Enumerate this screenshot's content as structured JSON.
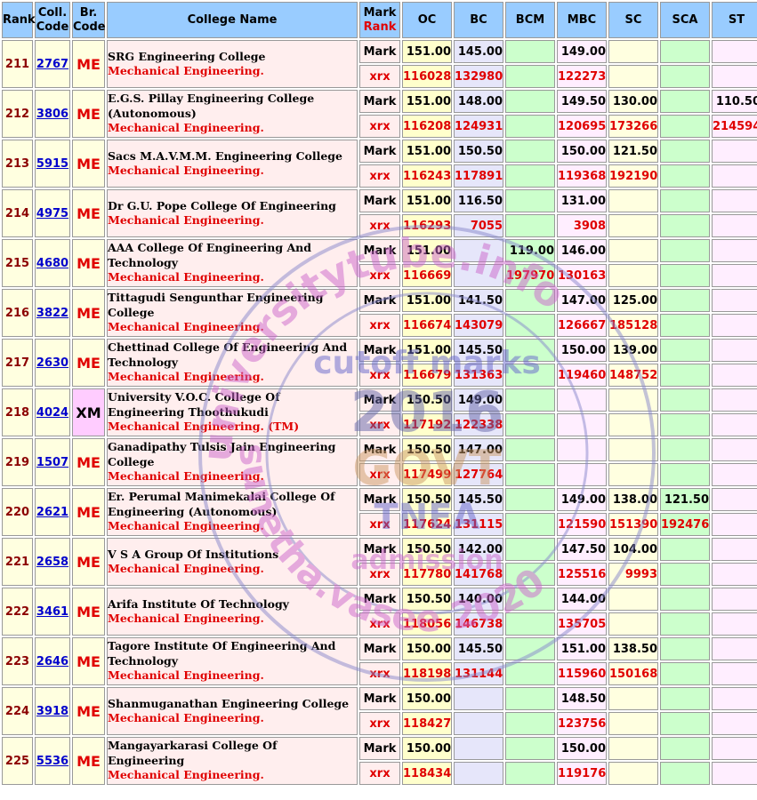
{
  "headers": {
    "rank": "Rank",
    "coll_code_1": "Coll.",
    "coll_code_2": "Code",
    "br_code_1": "Br.",
    "br_code_2": "Code",
    "college_name": "College Name",
    "mark": "Mark",
    "rank_red": "Rank",
    "oc": "OC",
    "bc": "BC",
    "bcm": "BCM",
    "mbc": "MBC",
    "sc": "SC",
    "sca": "SCA",
    "st": "ST"
  },
  "row_labels": {
    "mark": "Mark",
    "rank": "xrx"
  },
  "rows": [
    {
      "rank": "211",
      "code": "2767",
      "branch": "ME",
      "name": "SRG Engineering College",
      "branch_name": "Mechanical Engineering.",
      "marks": {
        "oc": "151.00",
        "bc": "145.00",
        "bcm": "",
        "mbc": "149.00",
        "sc": "",
        "sca": "",
        "st": ""
      },
      "ranks": {
        "oc": "116028",
        "bc": "132980",
        "bcm": "",
        "mbc": "122273",
        "sc": "",
        "sca": "",
        "st": ""
      }
    },
    {
      "rank": "212",
      "code": "3806",
      "branch": "ME",
      "name": "E.G.S. Pillay Engineering College (Autonomous)",
      "branch_name": "Mechanical Engineering.",
      "marks": {
        "oc": "151.00",
        "bc": "148.00",
        "bcm": "",
        "mbc": "149.50",
        "sc": "130.00",
        "sca": "",
        "st": "110.50"
      },
      "ranks": {
        "oc": "116208",
        "bc": "124931",
        "bcm": "",
        "mbc": "120695",
        "sc": "173266",
        "sca": "",
        "st": "214594"
      }
    },
    {
      "rank": "213",
      "code": "5915",
      "branch": "ME",
      "name": "Sacs M.A.V.M.M. Engineering College",
      "branch_name": "Mechanical Engineering.",
      "marks": {
        "oc": "151.00",
        "bc": "150.50",
        "bcm": "",
        "mbc": "150.00",
        "sc": "121.50",
        "sca": "",
        "st": ""
      },
      "ranks": {
        "oc": "116243",
        "bc": "117891",
        "bcm": "",
        "mbc": "119368",
        "sc": "192190",
        "sca": "",
        "st": ""
      }
    },
    {
      "rank": "214",
      "code": "4975",
      "branch": "ME",
      "name": "Dr G.U. Pope College Of Engineering",
      "branch_name": "Mechanical Engineering.",
      "marks": {
        "oc": "151.00",
        "bc": "116.50",
        "bcm": "",
        "mbc": "131.00",
        "sc": "",
        "sca": "",
        "st": ""
      },
      "ranks": {
        "oc": "116293",
        "bc": "7055",
        "bcm": "",
        "mbc": "3908",
        "sc": "",
        "sca": "",
        "st": ""
      }
    },
    {
      "rank": "215",
      "code": "4680",
      "branch": "ME",
      "name": "AAA College Of Engineering And Technology",
      "branch_name": "Mechanical Engineering.",
      "marks": {
        "oc": "151.00",
        "bc": "",
        "bcm": "119.00",
        "mbc": "146.00",
        "sc": "",
        "sca": "",
        "st": ""
      },
      "ranks": {
        "oc": "116669",
        "bc": "",
        "bcm": "197970",
        "mbc": "130163",
        "sc": "",
        "sca": "",
        "st": ""
      }
    },
    {
      "rank": "216",
      "code": "3822",
      "branch": "ME",
      "name": "Tittagudi Sengunthar Engineering College",
      "branch_name": "Mechanical Engineering.",
      "marks": {
        "oc": "151.00",
        "bc": "141.50",
        "bcm": "",
        "mbc": "147.00",
        "sc": "125.00",
        "sca": "",
        "st": ""
      },
      "ranks": {
        "oc": "116674",
        "bc": "143079",
        "bcm": "",
        "mbc": "126667",
        "sc": "185128",
        "sca": "",
        "st": ""
      }
    },
    {
      "rank": "217",
      "code": "2630",
      "branch": "ME",
      "name": "Chettinad College Of Engineering And Technology",
      "branch_name": "Mechanical Engineering.",
      "marks": {
        "oc": "151.00",
        "bc": "145.50",
        "bcm": "",
        "mbc": "150.00",
        "sc": "139.00",
        "sca": "",
        "st": ""
      },
      "ranks": {
        "oc": "116679",
        "bc": "131363",
        "bcm": "",
        "mbc": "119460",
        "sc": "148752",
        "sca": "",
        "st": ""
      }
    },
    {
      "rank": "218",
      "code": "4024",
      "branch": "XM",
      "name": "University V.O.C. College Of Engineering Thoothukudi",
      "branch_name": "Mechanical Engineering. (TM)",
      "marks": {
        "oc": "150.50",
        "bc": "149.00",
        "bcm": "",
        "mbc": "",
        "sc": "",
        "sca": "",
        "st": ""
      },
      "ranks": {
        "oc": "117192",
        "bc": "122338",
        "bcm": "",
        "mbc": "",
        "sc": "",
        "sca": "",
        "st": ""
      }
    },
    {
      "rank": "219",
      "code": "1507",
      "branch": "ME",
      "name": "Ganadipathy Tulsis Jain Engineering College",
      "branch_name": "Mechanical Engineering.",
      "marks": {
        "oc": "150.50",
        "bc": "147.00",
        "bcm": "",
        "mbc": "",
        "sc": "",
        "sca": "",
        "st": ""
      },
      "ranks": {
        "oc": "117499",
        "bc": "127764",
        "bcm": "",
        "mbc": "",
        "sc": "",
        "sca": "",
        "st": ""
      }
    },
    {
      "rank": "220",
      "code": "2621",
      "branch": "ME",
      "name": "Er. Perumal Manimekalai College Of Engineering (Autonomous)",
      "branch_name": "Mechanical Engineering.",
      "marks": {
        "oc": "150.50",
        "bc": "145.50",
        "bcm": "",
        "mbc": "149.00",
        "sc": "138.00",
        "sca": "121.50",
        "st": ""
      },
      "ranks": {
        "oc": "117624",
        "bc": "131115",
        "bcm": "",
        "mbc": "121590",
        "sc": "151390",
        "sca": "192476",
        "st": ""
      }
    },
    {
      "rank": "221",
      "code": "2658",
      "branch": "ME",
      "name": "V S A Group Of Institutions",
      "branch_name": "Mechanical Engineering.",
      "marks": {
        "oc": "150.50",
        "bc": "142.00",
        "bcm": "",
        "mbc": "147.50",
        "sc": "104.00",
        "sca": "",
        "st": ""
      },
      "ranks": {
        "oc": "117780",
        "bc": "141768",
        "bcm": "",
        "mbc": "125516",
        "sc": "9993",
        "sca": "",
        "st": ""
      }
    },
    {
      "rank": "222",
      "code": "3461",
      "branch": "ME",
      "name": "Arifa Institute Of Technology",
      "branch_name": "Mechanical Engineering.",
      "marks": {
        "oc": "150.50",
        "bc": "140.00",
        "bcm": "",
        "mbc": "144.00",
        "sc": "",
        "sca": "",
        "st": ""
      },
      "ranks": {
        "oc": "118056",
        "bc": "146738",
        "bcm": "",
        "mbc": "135705",
        "sc": "",
        "sca": "",
        "st": ""
      }
    },
    {
      "rank": "223",
      "code": "2646",
      "branch": "ME",
      "name": "Tagore Institute Of Engineering And Technology",
      "branch_name": "Mechanical Engineering.",
      "marks": {
        "oc": "150.00",
        "bc": "145.50",
        "bcm": "",
        "mbc": "151.00",
        "sc": "138.50",
        "sca": "",
        "st": ""
      },
      "ranks": {
        "oc": "118198",
        "bc": "131144",
        "bcm": "",
        "mbc": "115960",
        "sc": "150168",
        "sca": "",
        "st": ""
      }
    },
    {
      "rank": "224",
      "code": "3918",
      "branch": "ME",
      "name": "Shanmuganathan Engineering College",
      "branch_name": "Mechanical Engineering.",
      "marks": {
        "oc": "150.00",
        "bc": "",
        "bcm": "",
        "mbc": "148.50",
        "sc": "",
        "sca": "",
        "st": ""
      },
      "ranks": {
        "oc": "118427",
        "bc": "",
        "bcm": "",
        "mbc": "123756",
        "sc": "",
        "sca": "",
        "st": ""
      }
    },
    {
      "rank": "225",
      "code": "5536",
      "branch": "ME",
      "name": "Mangayarkarasi College Of Engineering",
      "branch_name": "Mechanical Engineering.",
      "marks": {
        "oc": "150.00",
        "bc": "",
        "bcm": "",
        "mbc": "150.00",
        "sc": "",
        "sca": "",
        "st": ""
      },
      "ranks": {
        "oc": "118434",
        "bc": "",
        "bcm": "",
        "mbc": "119176",
        "sc": "",
        "sca": "",
        "st": ""
      }
    }
  ],
  "watermark": {
    "line1": "universitytube.info",
    "line2": "cutoff marks",
    "line3": "2016",
    "line4": "GOVT",
    "line5": "TNEA",
    "line6": "admission",
    "line7": "sunetha.vasee 2020"
  }
}
